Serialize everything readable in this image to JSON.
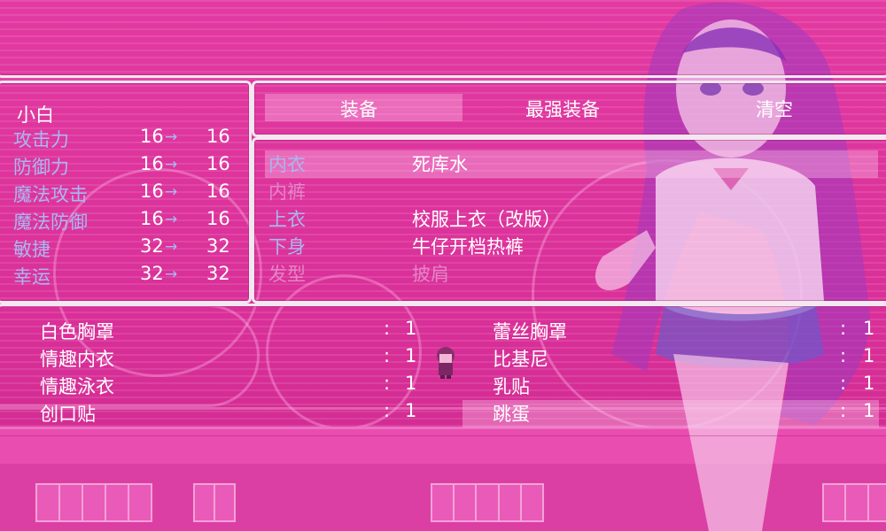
{
  "character": {
    "name": "小白",
    "stats": [
      {
        "label": "攻击力",
        "current": "16",
        "new": "16"
      },
      {
        "label": "防御力",
        "current": "16",
        "new": "16"
      },
      {
        "label": "魔法攻击",
        "current": "16",
        "new": "16"
      },
      {
        "label": "魔法防御",
        "current": "16",
        "new": "16"
      },
      {
        "label": "敏捷",
        "current": "32",
        "new": "32"
      },
      {
        "label": "幸运",
        "current": "32",
        "new": "32"
      }
    ],
    "arrow": "→"
  },
  "commands": {
    "equip": "装备",
    "optimize": "最强装备",
    "clear": "清空",
    "selected": "equip"
  },
  "slots": [
    {
      "slot": "内衣",
      "item": "死库水",
      "selected": true
    },
    {
      "slot": "内裤",
      "item": "",
      "selected": false
    },
    {
      "slot": "上衣",
      "item": "校服上衣（改版）",
      "selected": false
    },
    {
      "slot": "下身",
      "item": "牛仔开档热裤",
      "selected": false
    },
    {
      "slot": "发型",
      "item": "披肩",
      "selected": false
    }
  ],
  "items": {
    "colon": ":",
    "left": [
      {
        "name": "白色胸罩",
        "count": "1"
      },
      {
        "name": "情趣内衣",
        "count": "1"
      },
      {
        "name": "情趣泳衣",
        "count": "1"
      },
      {
        "name": "创口贴",
        "count": "1"
      }
    ],
    "right": [
      {
        "name": "蕾丝胸罩",
        "count": "1"
      },
      {
        "name": "比基尼",
        "count": "1"
      },
      {
        "name": "乳贴",
        "count": "1"
      },
      {
        "name": "跳蛋",
        "count": "1",
        "selected": true
      }
    ]
  },
  "colors": {
    "background": "#e0359e",
    "system_text": "#a9b7f2",
    "window_border": "#f4e7f0"
  }
}
